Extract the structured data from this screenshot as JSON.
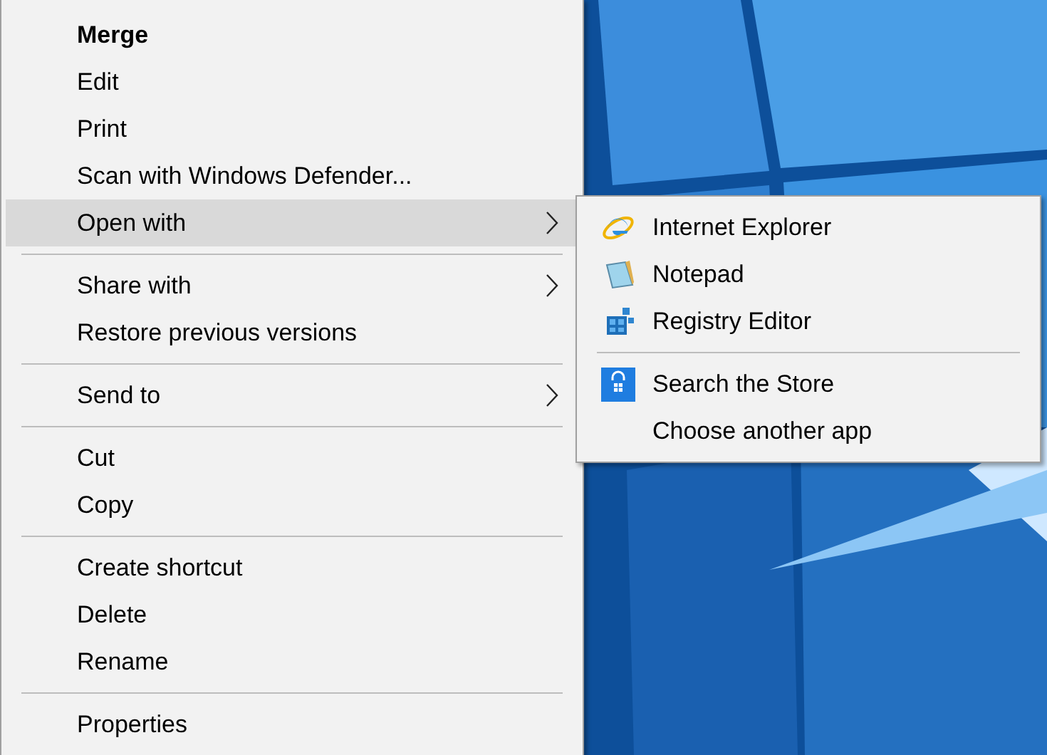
{
  "context_menu": {
    "items": [
      {
        "kind": "item",
        "label": "Merge",
        "bold": true,
        "selected": false,
        "submenu": false
      },
      {
        "kind": "item",
        "label": "Edit",
        "bold": false,
        "selected": false,
        "submenu": false
      },
      {
        "kind": "item",
        "label": "Print",
        "bold": false,
        "selected": false,
        "submenu": false
      },
      {
        "kind": "item",
        "label": "Scan with Windows Defender...",
        "bold": false,
        "selected": false,
        "submenu": false
      },
      {
        "kind": "item",
        "label": "Open with",
        "bold": false,
        "selected": true,
        "submenu": true
      },
      {
        "kind": "separator"
      },
      {
        "kind": "item",
        "label": "Share with",
        "bold": false,
        "selected": false,
        "submenu": true
      },
      {
        "kind": "item",
        "label": "Restore previous versions",
        "bold": false,
        "selected": false,
        "submenu": false
      },
      {
        "kind": "separator"
      },
      {
        "kind": "item",
        "label": "Send to",
        "bold": false,
        "selected": false,
        "submenu": true
      },
      {
        "kind": "separator"
      },
      {
        "kind": "item",
        "label": "Cut",
        "bold": false,
        "selected": false,
        "submenu": false
      },
      {
        "kind": "item",
        "label": "Copy",
        "bold": false,
        "selected": false,
        "submenu": false
      },
      {
        "kind": "separator"
      },
      {
        "kind": "item",
        "label": "Create shortcut",
        "bold": false,
        "selected": false,
        "submenu": false
      },
      {
        "kind": "item",
        "label": "Delete",
        "bold": false,
        "selected": false,
        "submenu": false
      },
      {
        "kind": "item",
        "label": "Rename",
        "bold": false,
        "selected": false,
        "submenu": false
      },
      {
        "kind": "separator"
      },
      {
        "kind": "item",
        "label": "Properties",
        "bold": false,
        "selected": false,
        "submenu": false
      }
    ]
  },
  "open_with_submenu": {
    "items": [
      {
        "kind": "item",
        "label": "Internet Explorer"
      },
      {
        "kind": "item",
        "label": "Notepad"
      },
      {
        "kind": "item",
        "label": "Registry Editor"
      },
      {
        "kind": "separator"
      },
      {
        "kind": "item",
        "label": "Search the Store"
      },
      {
        "kind": "item",
        "label": "Choose another app"
      }
    ]
  }
}
